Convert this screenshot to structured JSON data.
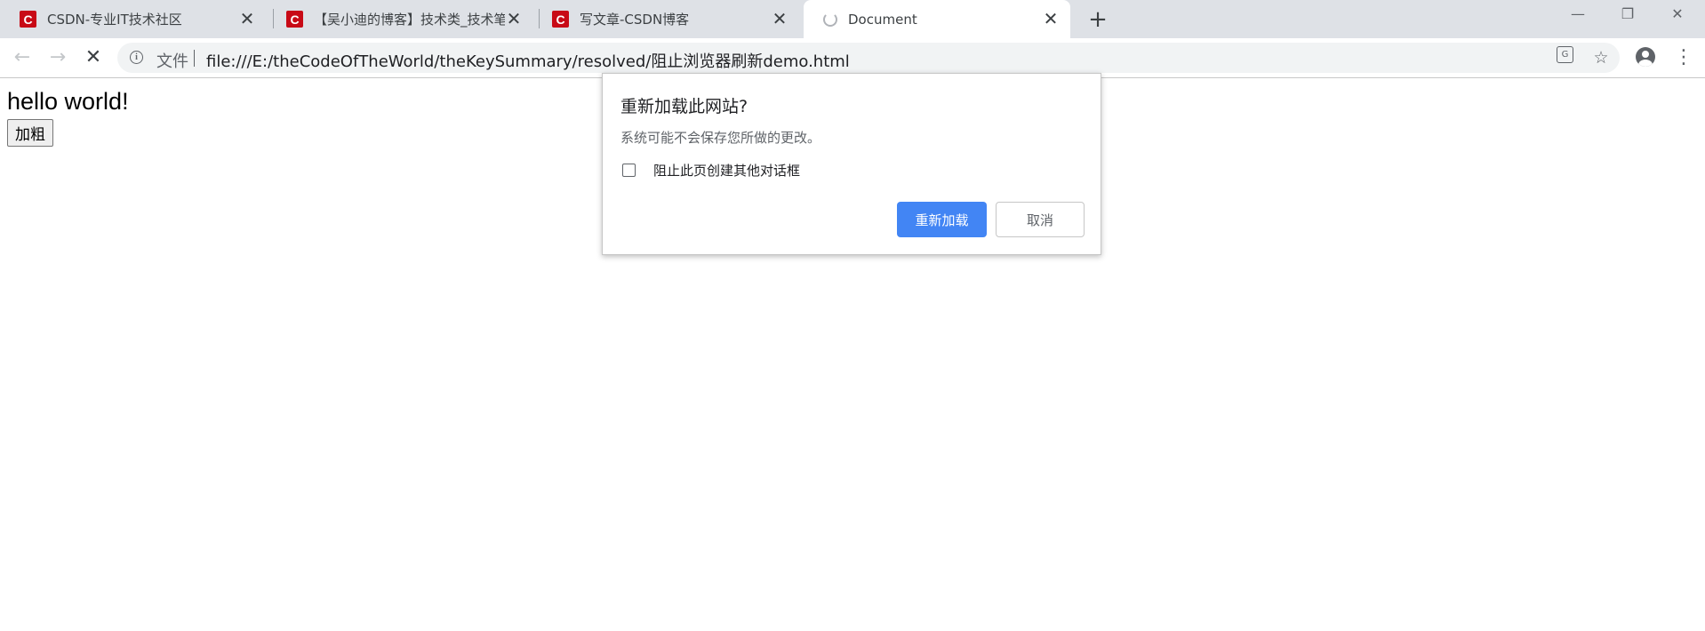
{
  "browser": {
    "tabs": [
      {
        "title": "CSDN-专业IT技术社区",
        "favicon": "csdn-logo",
        "close": "✕"
      },
      {
        "title": "【吴小迪的博客】技术类_技术笔",
        "favicon": "csdn-logo",
        "close": "✕"
      },
      {
        "title": "写文章-CSDN博客",
        "favicon": "csdn-logo",
        "close": "✕"
      },
      {
        "title": "Document",
        "favicon": "loading-spinner",
        "close": "✕",
        "active": true
      }
    ],
    "favicon_glyph": "C",
    "favicon_color": "#c80a16",
    "new_tab": "+",
    "window_controls": {
      "minimize": "—",
      "restore": "❐",
      "close": "✕"
    },
    "toolbar": {
      "back": "←",
      "forward": "→",
      "stop": "✕",
      "info": "i",
      "scheme_label": "文件",
      "url": "file:///E:/theCodeOfTheWorld/theKeySummary/resolved/阻止浏览器刷新demo.html",
      "translate_glyph": "G",
      "star": "☆",
      "menu": "⋮"
    }
  },
  "page": {
    "heading": "hello world!",
    "button_label": "加粗"
  },
  "dialog": {
    "title": "重新加载此网站?",
    "message": "系统可能不会保存您所做的更改。",
    "checkbox_label": "阻止此页创建其他对话框",
    "checkbox_checked": false,
    "reload_label": "重新加载",
    "cancel_label": "取消",
    "accent_color": "#4285f4"
  }
}
